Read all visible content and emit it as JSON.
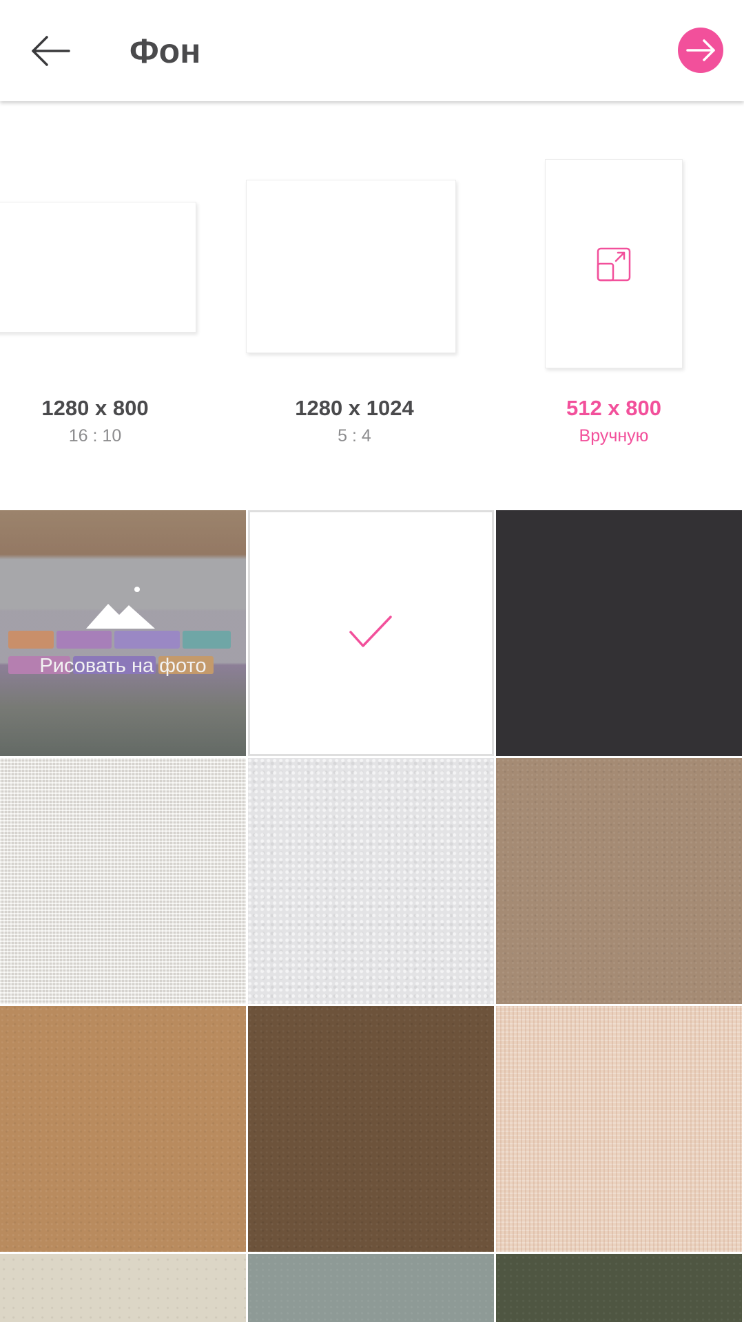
{
  "header": {
    "title": "Фон",
    "back_icon": "arrow-left-icon",
    "next_icon": "arrow-right-icon",
    "accent_color": "#f2509b"
  },
  "size_presets": [
    {
      "dimensions": "1280 x 800",
      "ratio": "16 : 10",
      "selected": false
    },
    {
      "dimensions": "1280 x 1024",
      "ratio": "5 : 4",
      "selected": false
    },
    {
      "dimensions": "512 x 800",
      "ratio": "Вручную",
      "selected": true,
      "icon": "resize-icon"
    }
  ],
  "backgrounds": {
    "draw_on_photo_label": "Рисовать на фото",
    "draw_on_photo_icon": "image-mountain-icon",
    "selected_icon": "checkmark-icon",
    "tiles": [
      {
        "name": "draw-on-photo"
      },
      {
        "name": "white",
        "color": "#ffffff",
        "selected": true
      },
      {
        "name": "dark",
        "color": "#333134"
      },
      {
        "name": "linen",
        "color": "#ece9e4"
      },
      {
        "name": "white-paper",
        "color": "#e3e3e5"
      },
      {
        "name": "kraft-paper",
        "color": "#a58b74"
      },
      {
        "name": "cardboard",
        "color": "#b98b5e"
      },
      {
        "name": "brown-paper",
        "color": "#6d533b"
      },
      {
        "name": "peach-canvas",
        "color": "#ead2bf"
      },
      {
        "name": "cream-paper",
        "color": "#dcd6c6"
      },
      {
        "name": "slate-paper",
        "color": "#8e9a96"
      },
      {
        "name": "olive-paper",
        "color": "#4f5642"
      }
    ]
  }
}
